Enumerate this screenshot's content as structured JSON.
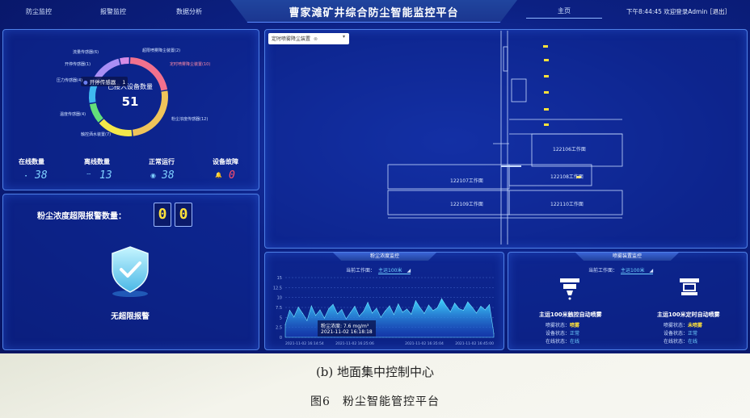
{
  "nav": [
    "防尘监控",
    "报警监控",
    "数据分析"
  ],
  "title": "曹家滩矿井综合防尘智能监控平台",
  "home_tab": "主页",
  "clock": "下午8:44:45 欢迎登录Admin",
  "logout": "［退出］",
  "devices": {
    "center_label": "已接入设备数量",
    "center_value": "51",
    "tooltip_name": "开停传感器",
    "tooltip_value": "1",
    "segments": [
      {
        "name": "粉尘浓度传感器",
        "value": 12,
        "color": "#f0c45a"
      },
      {
        "name": "触控洒水装置",
        "value": 7,
        "color": "#f4e84a"
      },
      {
        "name": "温度传感器",
        "value": 4,
        "color": "#63e07a"
      },
      {
        "name": "压力传感器",
        "value": 4,
        "color": "#3fb9f0"
      },
      {
        "name": "开停传感器",
        "value": 1,
        "color": "#6a7ef0"
      },
      {
        "name": "流量传感器",
        "value": 6,
        "color": "#a98ef5"
      },
      {
        "name": "超限喷雾降尘装置",
        "value": 2,
        "color": "#d58be6"
      },
      {
        "name": "定时喷雾降尘装置",
        "value": 10,
        "color": "#f2718e"
      }
    ],
    "ring_labels": {
      "flow": "流量传感器(6)",
      "switch": "开停传感器(1)",
      "pressure": "压力传感器(4)",
      "temperature": "温度传感器(4)",
      "water": "触控洒水装置(7)",
      "dust": "粉尘浓度传感器(12)",
      "overlimit": "超限喷雾降尘装置(2)",
      "timed": "定时喷雾降尘装置(10)"
    },
    "stats": [
      {
        "title": "在线数量",
        "value": "38",
        "icon": "⬝",
        "color": "#7fd1ff"
      },
      {
        "title": "离线数量",
        "value": "13",
        "icon": "⌔",
        "color": "#7fd1ff"
      },
      {
        "title": "正常运行",
        "value": "38",
        "icon": "◉",
        "color": "#7fd1ff"
      },
      {
        "title": "设备故障",
        "value": "0",
        "icon": "🔔",
        "color": "#ffcc33"
      }
    ]
  },
  "alarm": {
    "label": "粉尘浓度超限报警数量：",
    "digits": [
      "0",
      "0"
    ],
    "status": "无超限报警"
  },
  "map": {
    "select_value": "定时喷雾降尘装置",
    "faces": [
      "122106工作面",
      "122107工作面",
      "122108工作面",
      "122109工作面",
      "122110工作面"
    ]
  },
  "dust_chart": {
    "tab": "粉尘浓度监控",
    "face_label": "当前工作面：",
    "face_value": "主运100米",
    "tooltip_value": "粉尘浓度: 7.6 mg/m³",
    "tooltip_time": "2021-11-02 16:18:18",
    "x_ticks": [
      "2021-11-02 16:14:54",
      "2021-11-02 16:25:06",
      "2021-11-02 16:35:04",
      "2021-11-02 16:45:00"
    ]
  },
  "chart_data": {
    "type": "area",
    "y_ticks": [
      "0",
      "2.5",
      "5",
      "7.5",
      "10",
      "12.5",
      "15"
    ],
    "ylim": [
      0,
      15
    ],
    "grid": true,
    "values": [
      3.2,
      6.8,
      5.1,
      7.6,
      6.0,
      4.2,
      7.9,
      5.5,
      6.9,
      4.8,
      7.2,
      8.3,
      5.9,
      7.0,
      4.6,
      6.2,
      7.8,
      5.3,
      6.5,
      8.8,
      6.1,
      7.3,
      5.0,
      6.6,
      7.9,
      5.7,
      8.4,
      6.3,
      7.1,
      5.8,
      9.2,
      7.5,
      6.0,
      8.1,
      6.7,
      7.4,
      9.7,
      7.9,
      6.4,
      8.6,
      7.2,
      6.8,
      8.9,
      7.6,
      6.1,
      7.8,
      6.9,
      8.2,
      1.0
    ]
  },
  "spray": {
    "tab": "喷雾装置监控",
    "face_label": "当前工作面：",
    "face_value": "主运100米",
    "devices": [
      {
        "title": "主运100米触控自动喷雾",
        "rows": [
          {
            "label": "喷雾状态：",
            "value": "喷雾",
            "style": "b"
          },
          {
            "label": "设备状态：",
            "value": "正常",
            "style": "i"
          },
          {
            "label": "在线状态：",
            "value": "在线",
            "style": "i"
          }
        ]
      },
      {
        "title": "主运100米定时自动喷雾",
        "rows": [
          {
            "label": "喷雾状态：",
            "value": "未喷雾",
            "style": "b"
          },
          {
            "label": "设备状态：",
            "value": "正常",
            "style": "i"
          },
          {
            "label": "在线状态：",
            "value": "在线",
            "style": "i"
          }
        ]
      }
    ]
  },
  "captions": {
    "sub": "(b) 地面集中控制中心",
    "fig": "图6　粉尘智能管控平台"
  }
}
